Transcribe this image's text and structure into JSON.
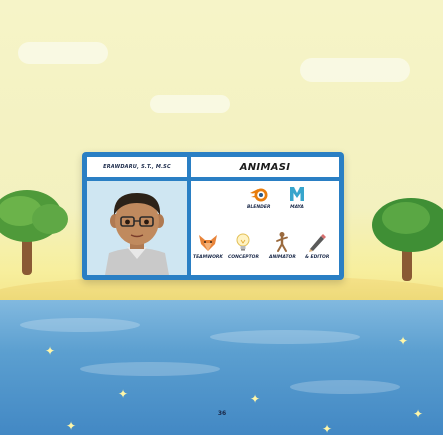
{
  "profile": {
    "name": "ERAWDARU, S.T., M.SC",
    "section_title": "ANIMASI"
  },
  "skills": [
    {
      "label": "BLENDER",
      "icon": "blender-icon"
    },
    {
      "label": "MAYA",
      "icon": "maya-icon"
    },
    {
      "label": "TEAMWORK",
      "icon": "fox-teamwork-icon"
    },
    {
      "label": "CONCEPTOR",
      "icon": "lightbulb-icon"
    },
    {
      "label": "ANIMATOR",
      "icon": "walking-figure-icon"
    },
    {
      "label": "& EDITOR",
      "icon": "pencil-icon"
    }
  ],
  "page_number": "36",
  "colors": {
    "card_frame": "#2a7fc4",
    "blender_orange": "#e87d0d",
    "maya_teal": "#37a5cc",
    "sea": "#3e84c2"
  }
}
